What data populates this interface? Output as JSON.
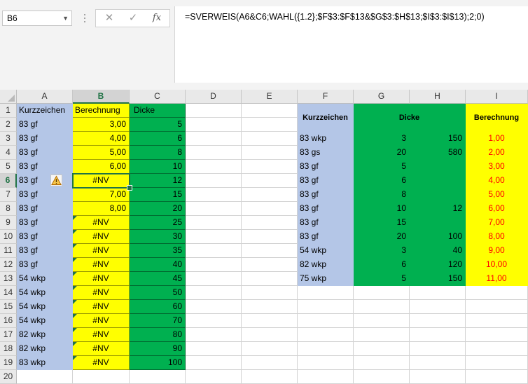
{
  "name_box": "B6",
  "formula": "=SVERWEIS(A6&C6;WAHL({1.2};$F$3:$F$13&$G$3:$H$13;$I$3:$I$13);2;0)",
  "formula_buttons": {
    "cancel": "✕",
    "enter": "✓",
    "fx": "fx"
  },
  "columns": [
    "A",
    "B",
    "C",
    "D",
    "E",
    "F",
    "G",
    "H",
    "I"
  ],
  "rows": [
    "1",
    "2",
    "3",
    "4",
    "5",
    "6",
    "7",
    "8",
    "9",
    "10",
    "11",
    "12",
    "13",
    "14",
    "15",
    "16",
    "17",
    "18",
    "19",
    "20"
  ],
  "selected_cell": {
    "column": "B",
    "row": "6"
  },
  "left_table": {
    "headers": [
      "Kurzzeichen",
      "Berechnung",
      "Dicke"
    ],
    "rows": [
      [
        "83 gf",
        "3,00",
        "5"
      ],
      [
        "83 gf",
        "4,00",
        "6"
      ],
      [
        "83 gf",
        "5,00",
        "8"
      ],
      [
        "83 gf",
        "6,00",
        "10"
      ],
      [
        "83 gf",
        "#NV",
        "12"
      ],
      [
        "83 gf",
        "7,00",
        "15"
      ],
      [
        "83 gf",
        "8,00",
        "20"
      ],
      [
        "83 gf",
        "#NV",
        "25"
      ],
      [
        "83 gf",
        "#NV",
        "30"
      ],
      [
        "83 gf",
        "#NV",
        "35"
      ],
      [
        "83 gf",
        "#NV",
        "40"
      ],
      [
        "54 wkp",
        "#NV",
        "45"
      ],
      [
        "54 wkp",
        "#NV",
        "50"
      ],
      [
        "54 wkp",
        "#NV",
        "60"
      ],
      [
        "54 wkp",
        "#NV",
        "70"
      ],
      [
        "82 wkp",
        "#NV",
        "80"
      ],
      [
        "82 wkp",
        "#NV",
        "90"
      ],
      [
        "83 wkp",
        "#NV",
        "100"
      ]
    ]
  },
  "right_table": {
    "headers": {
      "kurzzeichen": "Kurzzeichen",
      "dicke": "Dicke",
      "berechnung": "Berechnung"
    },
    "rows": [
      [
        "83 wkp",
        "3",
        "150",
        "1,00"
      ],
      [
        "83 gs",
        "20",
        "580",
        "2,00"
      ],
      [
        "83 gf",
        "5",
        "",
        "3,00"
      ],
      [
        "83 gf",
        "6",
        "",
        "4,00"
      ],
      [
        "83 gf",
        "8",
        "",
        "5,00"
      ],
      [
        "83 gf",
        "10",
        "12",
        "6,00"
      ],
      [
        "83 gf",
        "15",
        "",
        "7,00"
      ],
      [
        "83 gf",
        "20",
        "100",
        "8,00"
      ],
      [
        "54 wkp",
        "3",
        "40",
        "9,00"
      ],
      [
        "82 wkp",
        "6",
        "120",
        "10,00"
      ],
      [
        "75 wkp",
        "5",
        "150",
        "11,00"
      ]
    ]
  },
  "colors": {
    "blue": "#b4c6e7",
    "yellow": "#ffff00",
    "green": "#00b050",
    "red": "#ff0000",
    "excel_green": "#217346"
  },
  "icons": {
    "warning": "warning-icon",
    "fx": "function-icon"
  }
}
